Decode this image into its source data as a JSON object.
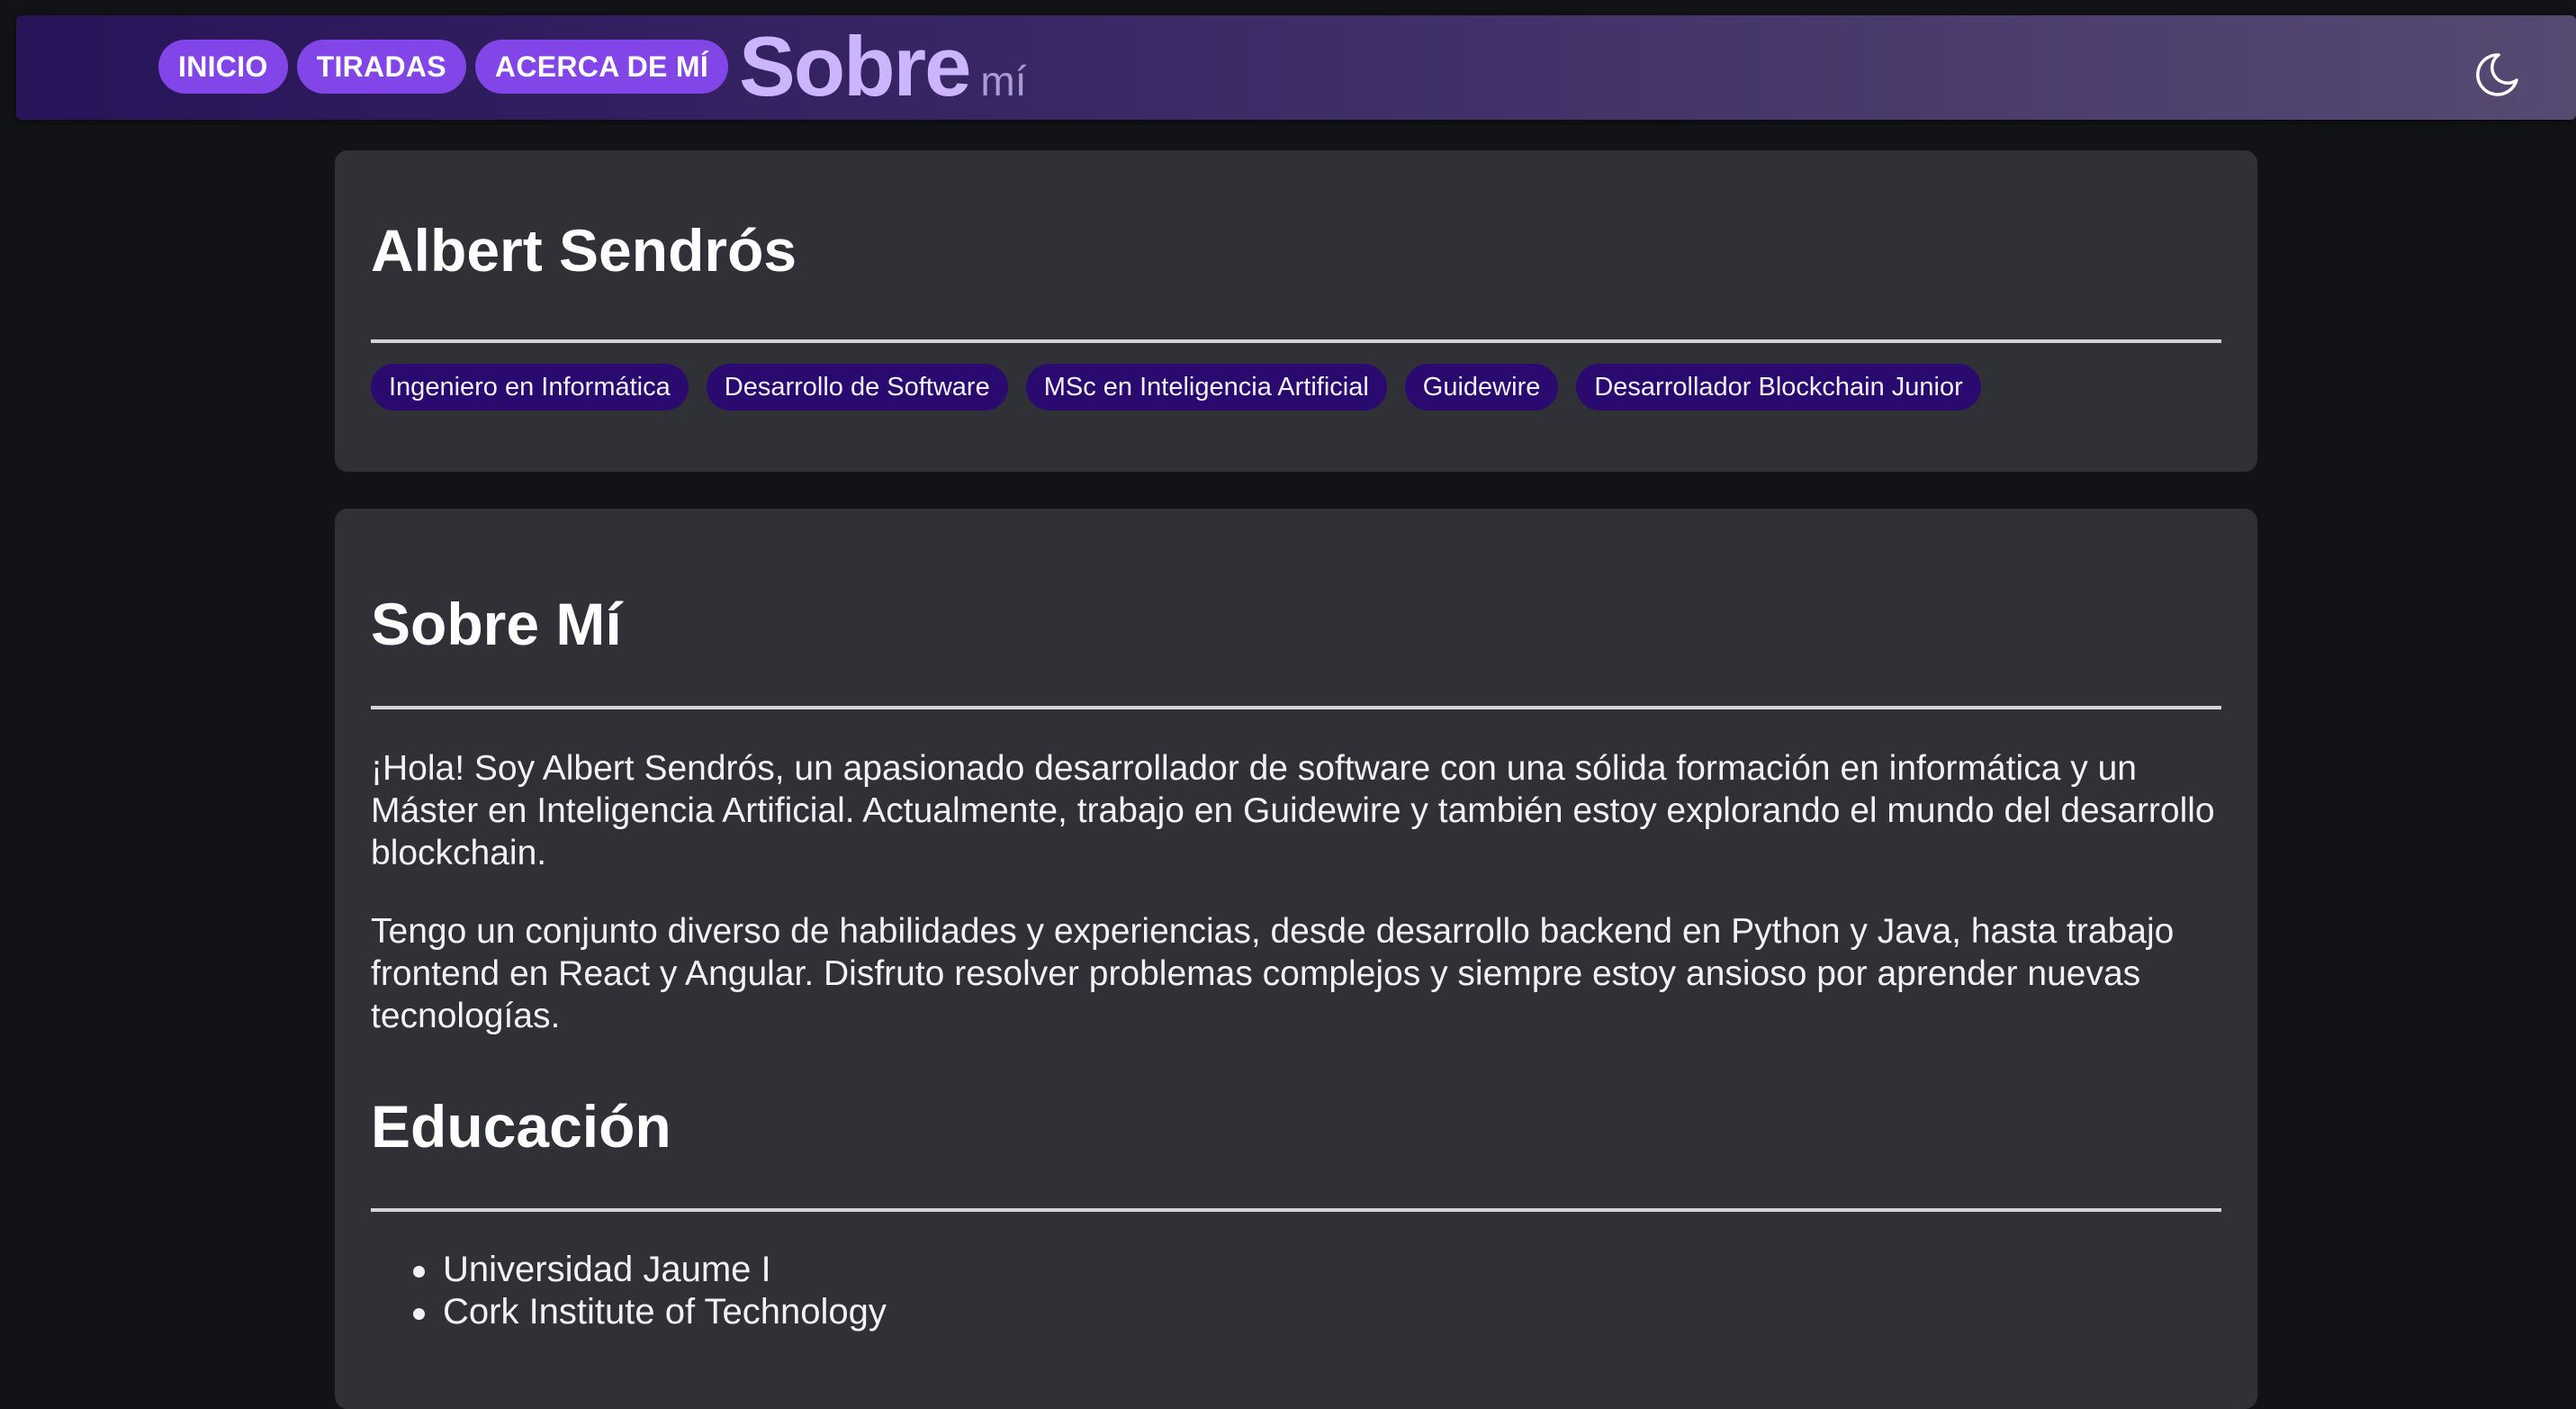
{
  "nav": {
    "items": [
      {
        "label": "INICIO"
      },
      {
        "label": "TIRADAS"
      },
      {
        "label": "ACERCA DE MÍ"
      }
    ]
  },
  "brand": {
    "title": "Sobre",
    "subtitle": "mí"
  },
  "theme_toggle": {
    "icon": "moon-icon"
  },
  "profile": {
    "name": "Albert Sendrós",
    "tags": [
      "Ingeniero en Informática",
      "Desarrollo de Software",
      "MSc en Inteligencia Artificial",
      "Guidewire",
      "Desarrollador Blockchain Junior"
    ]
  },
  "about": {
    "heading": "Sobre Mí",
    "paragraphs": [
      "¡Hola! Soy Albert Sendrós, un apasionado desarrollador de software con una sólida formación en informática y un Máster en Inteligencia Artificial. Actualmente, trabajo en Guidewire y también estoy explorando el mundo del desarrollo blockchain.",
      "Tengo un conjunto diverso de habilidades y experiencias, desde desarrollo backend en Python y Java, hasta trabajo frontend en React y Angular. Disfruto resolver problemas complejos y siempre estoy ansioso por aprender nuevas tecnologías."
    ]
  },
  "education": {
    "heading": "Educación",
    "items": [
      "Universidad Jaume I",
      "Cork Institute of Technology"
    ]
  },
  "colors": {
    "background": "#121317",
    "card": "#2f3137",
    "nav_pill": "#8245e8",
    "tag": "#2a0a6e",
    "brand": "#cdb4ff"
  }
}
